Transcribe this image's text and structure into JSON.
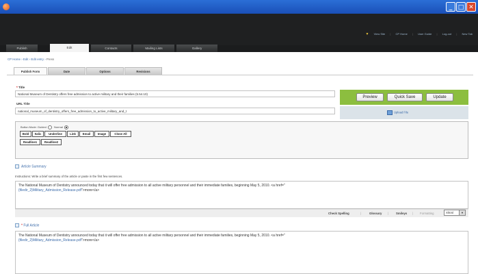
{
  "window": {
    "min": "_",
    "max": "□",
    "close": "✕"
  },
  "header": {
    "links": [
      "View Site",
      "CP Home",
      "User Guide",
      "Log-out",
      "New Tab"
    ]
  },
  "nav": {
    "tabs": [
      "Publish",
      "Edit",
      "Contacts",
      "Mailing Lists",
      "Gallery"
    ],
    "active": "Edit"
  },
  "breadcrumb": {
    "items": [
      "CP Home",
      "Edit",
      "Edit entry"
    ],
    "current": "Press",
    "separator": "›"
  },
  "subtabs": {
    "tabs": [
      "Publish Form",
      "Date",
      "Options",
      "Revisions"
    ],
    "active": "Publish Form"
  },
  "form": {
    "title_label": "Title",
    "title_value": "National Museum of Dentistry offers free admission to active military and their families (5.54.10)",
    "url_label": "URL Title",
    "url_value": "national_museum_of_dentistry_offers_free_admission_to_active_military_and_t"
  },
  "actions": {
    "preview": "Preview",
    "quicksave": "Quick Save",
    "update": "Update",
    "upload": "Upload File"
  },
  "toolbar": {
    "mode_label": "Button Mode:",
    "guided": "Guided",
    "normal": "Normal",
    "row1": [
      "Bold",
      "Italic",
      "Underline",
      "Link",
      "Email",
      "Image",
      "Close All"
    ],
    "row2": [
      "Readline1",
      "Readline2"
    ]
  },
  "summary": {
    "heading": "Article Summary",
    "instructions": "Instructions: Write a brief summary of the article or paste in the first few sentences.",
    "text_line1": "The National Museum of Dentistry announced today that it will offer free admission to all active military personnel and their immediate families, beginning May 5, 2010.  <a href=\"",
    "text_line2_link": "{filedir_2}Military_Admission_Release.pdf",
    "text_line2_rest": "\">more</a>"
  },
  "tools": {
    "check_spelling": "Check Spelling",
    "glossary": "Glossary",
    "smileys": "Smileys",
    "formatting": "Formatting",
    "format_value": "Xhtml"
  },
  "full": {
    "heading": "Full Article",
    "text_line1": "The National Museum of Dentistry announced today that it will offer free admission to all active military personnel and their immediate families, beginning May 5, 2010.  <a href=\"",
    "text_line2_link": "{filedir_2}Military_Admission_Release.pdf",
    "text_line2_rest": "\">more</a>"
  }
}
